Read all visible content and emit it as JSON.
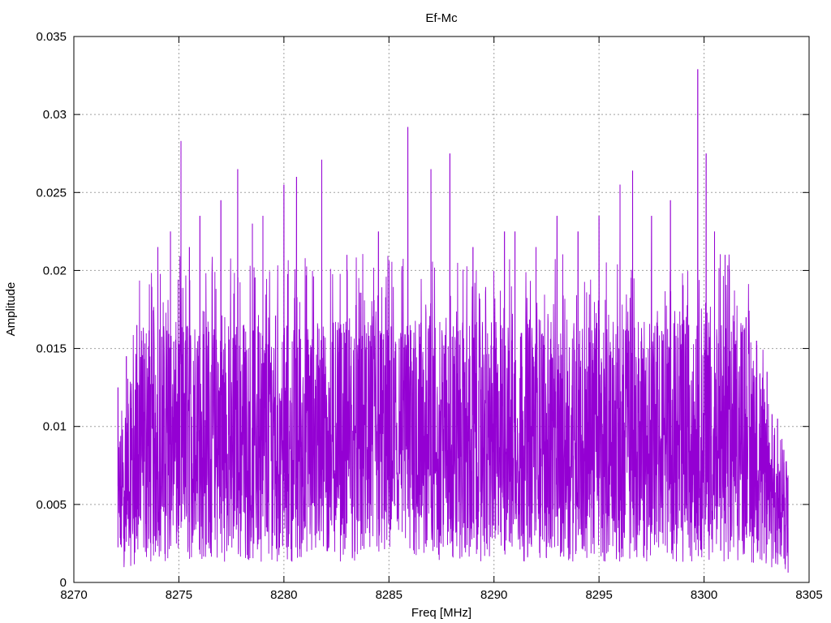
{
  "chart_data": {
    "type": "line",
    "title": "Ef-Mc",
    "xlabel": "Freq [MHz]",
    "ylabel": "Amplitude",
    "xlim": [
      8270,
      8305
    ],
    "ylim": [
      0,
      0.035
    ],
    "xticks": [
      8270,
      8275,
      8280,
      8285,
      8290,
      8295,
      8300,
      8305
    ],
    "xtick_labels": [
      "8270",
      "8275",
      "8280",
      "8285",
      "8290",
      "8295",
      "8300",
      "8305"
    ],
    "yticks": [
      0,
      0.005,
      0.01,
      0.015,
      0.02,
      0.025,
      0.03,
      0.035
    ],
    "ytick_labels": [
      "0",
      "0.005",
      "0.01",
      "0.015",
      "0.02",
      "0.025",
      "0.03",
      "0.035"
    ],
    "grid": true,
    "legend": "none",
    "series": [
      {
        "color": "#9400d3",
        "x": [
          8272.1,
          8272.5,
          8273.0,
          8274.0,
          8274.6,
          8275.1,
          8275.5,
          8276.0,
          8277.0,
          8277.8,
          8278.5,
          8279.0,
          8280.0,
          8280.6,
          8281.8,
          8283.0,
          8284.5,
          8285.9,
          8287.0,
          8287.9,
          8289.0,
          8290.5,
          8291.0,
          8292.0,
          8293.0,
          8294.0,
          8295.0,
          8296.0,
          8296.6,
          8297.5,
          8298.4,
          8299.7,
          8300.1,
          8300.5,
          8301.0,
          8302.0,
          8302.5,
          8303.0,
          8303.5,
          8303.8,
          8304.0
        ],
        "values": [
          0.0125,
          0.0145,
          0.0165,
          0.0215,
          0.0225,
          0.0283,
          0.0215,
          0.0235,
          0.0245,
          0.0265,
          0.023,
          0.0235,
          0.0255,
          0.026,
          0.0271,
          0.021,
          0.0225,
          0.0292,
          0.0265,
          0.0275,
          0.0215,
          0.0225,
          0.0225,
          0.0215,
          0.0235,
          0.0225,
          0.0235,
          0.0255,
          0.0264,
          0.0235,
          0.0245,
          0.0329,
          0.0275,
          0.0225,
          0.021,
          0.017,
          0.0155,
          0.0135,
          0.0105,
          0.0085,
          0.0035
        ]
      }
    ]
  }
}
